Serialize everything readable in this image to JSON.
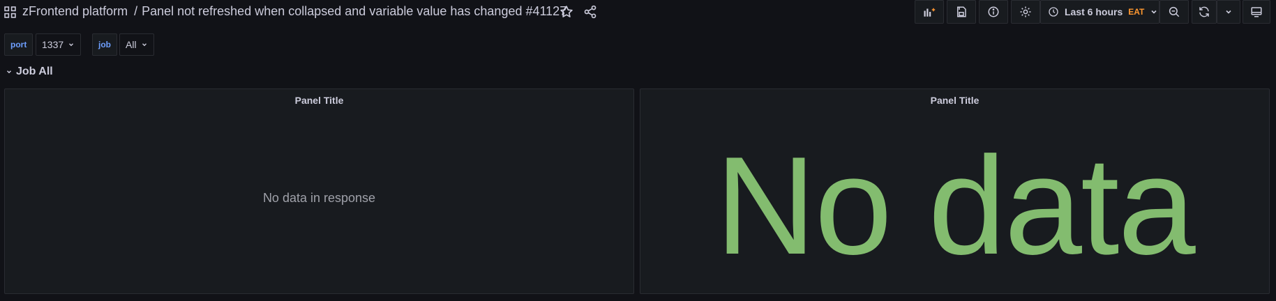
{
  "dashboard": {
    "folder": "zFrontend platform",
    "separator": "/",
    "title": "Panel not refreshed when collapsed and variable value has changed #41127"
  },
  "toolbar": {
    "time_range": "Last 6 hours",
    "timezone": "EAT",
    "icons": [
      "add-panel-icon",
      "save-icon",
      "info-icon",
      "settings-icon",
      "zoom-out-icon",
      "refresh-icon",
      "tv-mode-icon"
    ],
    "colors": {
      "timezone": "#ff9830",
      "accent": "#6e9fff"
    }
  },
  "variables": [
    {
      "label": "port",
      "value": "1337"
    },
    {
      "label": "job",
      "value": "All"
    }
  ],
  "row": {
    "title": "Job All"
  },
  "panels": [
    {
      "title": "Panel Title",
      "message": "No data in response"
    },
    {
      "title": "Panel Title",
      "message": "No data",
      "color": "#83bc6f"
    }
  ]
}
